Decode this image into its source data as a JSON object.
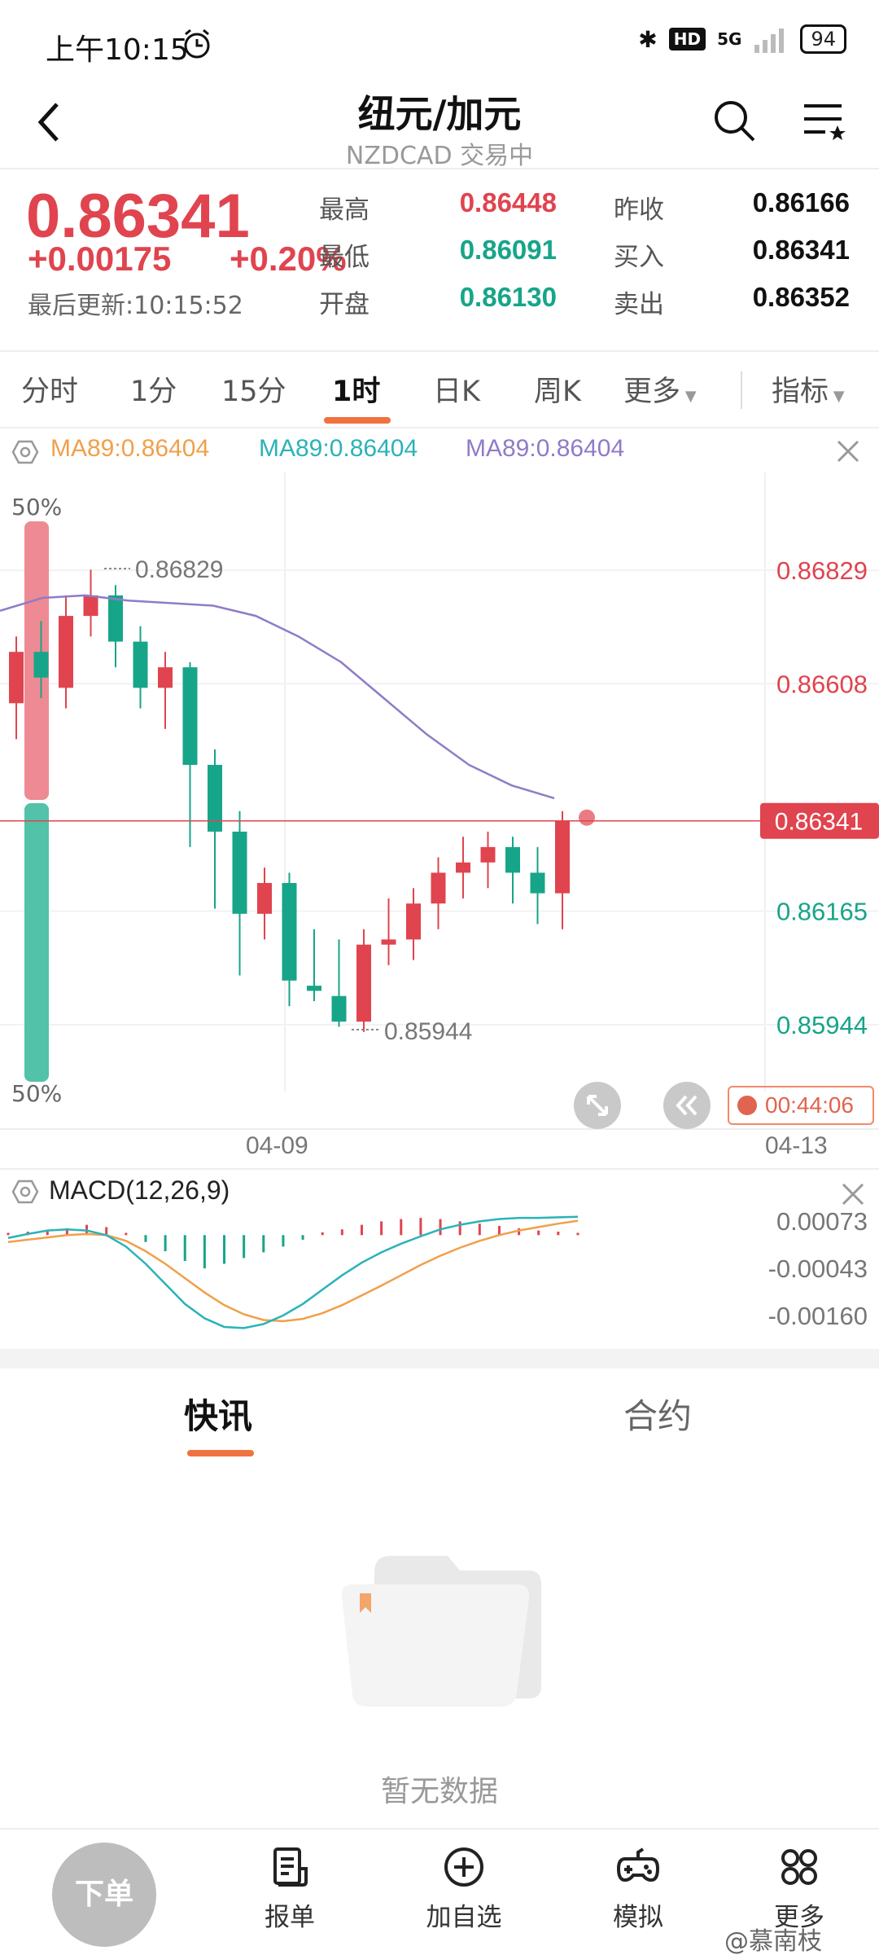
{
  "status_bar": {
    "time": "上午10:15",
    "network": "5G",
    "hd": "HD",
    "battery": "94"
  },
  "header": {
    "title": "纽元/加元",
    "subtitle": "NZDCAD 交易中"
  },
  "quote": {
    "price": "0.86341",
    "change": "+0.00175",
    "change_pct": "+0.20%",
    "updated": "最后更新:10:15:52",
    "stats": [
      {
        "label": "最高",
        "value": "0.86448"
      },
      {
        "label": "最低",
        "value": "0.86091"
      },
      {
        "label": "开盘",
        "value": "0.86130"
      },
      {
        "label": "昨收",
        "value": "0.86166"
      },
      {
        "label": "买入",
        "value": "0.86341"
      },
      {
        "label": "卖出",
        "value": "0.86352"
      }
    ]
  },
  "tabs": [
    "分时",
    "1分",
    "15分",
    "1时",
    "日K",
    "周K",
    "更多",
    "指标"
  ],
  "active_tab": "1时",
  "indicator": {
    "ma1": "MA89:0.86404",
    "ma2": "MA89:0.86404",
    "ma3": "MA89:0.86404"
  },
  "chart_data": [
    {
      "type": "candlestick",
      "interval": "1时",
      "y_ticks": [
        "0.86829",
        "0.86608",
        "0.86341",
        "0.86165",
        "0.85944"
      ],
      "ylim": [
        0.85944,
        0.86829
      ],
      "current_price": "0.86341",
      "high_marker": "0.86829",
      "low_marker": "0.85944",
      "x_ticks": [
        "04-09",
        "04-13"
      ],
      "buy_sell_pct_top": "50%",
      "buy_sell_pct_bottom": "50%",
      "countdown": "00:44:06",
      "ma_line": [
        0.8675,
        0.86775,
        0.8678,
        0.8677,
        0.86765,
        0.8676,
        0.8674,
        0.867,
        0.8665,
        0.8658,
        0.8651,
        0.8645,
        0.8641,
        0.86385
      ],
      "candles": [
        {
          "o": 0.8657,
          "c": 0.8667,
          "h": 0.867,
          "l": 0.865
        },
        {
          "o": 0.8667,
          "c": 0.8662,
          "h": 0.8673,
          "l": 0.8658
        },
        {
          "o": 0.866,
          "c": 0.8674,
          "h": 0.8678,
          "l": 0.8656
        },
        {
          "o": 0.8674,
          "c": 0.8678,
          "h": 0.8683,
          "l": 0.867
        },
        {
          "o": 0.8678,
          "c": 0.8669,
          "h": 0.868,
          "l": 0.8664
        },
        {
          "o": 0.8669,
          "c": 0.866,
          "h": 0.8672,
          "l": 0.8656
        },
        {
          "o": 0.866,
          "c": 0.8664,
          "h": 0.8667,
          "l": 0.8652
        },
        {
          "o": 0.8664,
          "c": 0.8645,
          "h": 0.8665,
          "l": 0.8629
        },
        {
          "o": 0.8645,
          "c": 0.8632,
          "h": 0.8648,
          "l": 0.8617
        },
        {
          "o": 0.8632,
          "c": 0.8616,
          "h": 0.8636,
          "l": 0.8604
        },
        {
          "o": 0.8616,
          "c": 0.8622,
          "h": 0.8625,
          "l": 0.8611
        },
        {
          "o": 0.8622,
          "c": 0.8603,
          "h": 0.8624,
          "l": 0.8598
        },
        {
          "o": 0.8602,
          "c": 0.8601,
          "h": 0.8613,
          "l": 0.8599
        },
        {
          "o": 0.86,
          "c": 0.8595,
          "h": 0.8611,
          "l": 0.8594
        },
        {
          "o": 0.8595,
          "c": 0.861,
          "h": 0.8613,
          "l": 0.8593
        },
        {
          "o": 0.861,
          "c": 0.8611,
          "h": 0.8619,
          "l": 0.8606
        },
        {
          "o": 0.8611,
          "c": 0.8618,
          "h": 0.8621,
          "l": 0.8607
        },
        {
          "o": 0.8618,
          "c": 0.8624,
          "h": 0.8627,
          "l": 0.8613
        },
        {
          "o": 0.8624,
          "c": 0.8626,
          "h": 0.8631,
          "l": 0.8619
        },
        {
          "o": 0.8626,
          "c": 0.8629,
          "h": 0.8632,
          "l": 0.8621
        },
        {
          "o": 0.8629,
          "c": 0.8624,
          "h": 0.8631,
          "l": 0.8618
        },
        {
          "o": 0.8624,
          "c": 0.862,
          "h": 0.8629,
          "l": 0.8614
        },
        {
          "o": 0.862,
          "c": 0.8634,
          "h": 0.8636,
          "l": 0.8613
        }
      ]
    },
    {
      "type": "macd",
      "title": "MACD(12,26,9)",
      "y_ticks": [
        "0.00073",
        "-0.00043",
        "-0.00160"
      ],
      "histogram": [
        4e-05,
        6e-05,
        8e-05,
        0.00012,
        0.00018,
        0.00014,
        4e-05,
        -0.00012,
        -0.00028,
        -0.00045,
        -0.00058,
        -0.0005,
        -0.0004,
        -0.0003,
        -0.0002,
        -8e-05,
        5e-05,
        0.0001,
        0.00018,
        0.00024,
        0.00028,
        0.0003,
        0.00028,
        0.00024,
        0.0002,
        0.00016,
        0.00012,
        8e-05,
        6e-05,
        4e-05
      ],
      "dif": [
        -5e-05,
        2e-05,
        8e-05,
        0.0001,
        8e-05,
        0.0,
        -0.0002,
        -0.0005,
        -0.00085,
        -0.0012,
        -0.00145,
        -0.0016,
        -0.00162,
        -0.00155,
        -0.0014,
        -0.0012,
        -0.00095,
        -0.0007,
        -0.00048,
        -0.0003,
        -0.00015,
        -2e-05,
        0.0001,
        0.00018,
        0.00024,
        0.00028,
        0.0003,
        0.0003,
        0.00031,
        0.00032
      ],
      "dea": [
        -0.00012,
        -8e-05,
        -4e-05,
        0.0,
        2e-05,
        0.0,
        -0.0001,
        -0.00028,
        -0.0005,
        -0.00075,
        -0.001,
        -0.00122,
        -0.00138,
        -0.00148,
        -0.0015,
        -0.00146,
        -0.00136,
        -0.00122,
        -0.00105,
        -0.00088,
        -0.0007,
        -0.00052,
        -0.00036,
        -0.00022,
        -0.0001,
        0.0,
        8e-05,
        0.00014,
        0.0002,
        0.00025
      ]
    }
  ],
  "news_tabs": [
    "快讯",
    "合约"
  ],
  "empty_text": "暂无数据",
  "bottom_bar": {
    "order": "下单",
    "items": [
      "报单",
      "加自选",
      "模拟",
      "更多"
    ]
  },
  "watermark": "@慕南枝"
}
